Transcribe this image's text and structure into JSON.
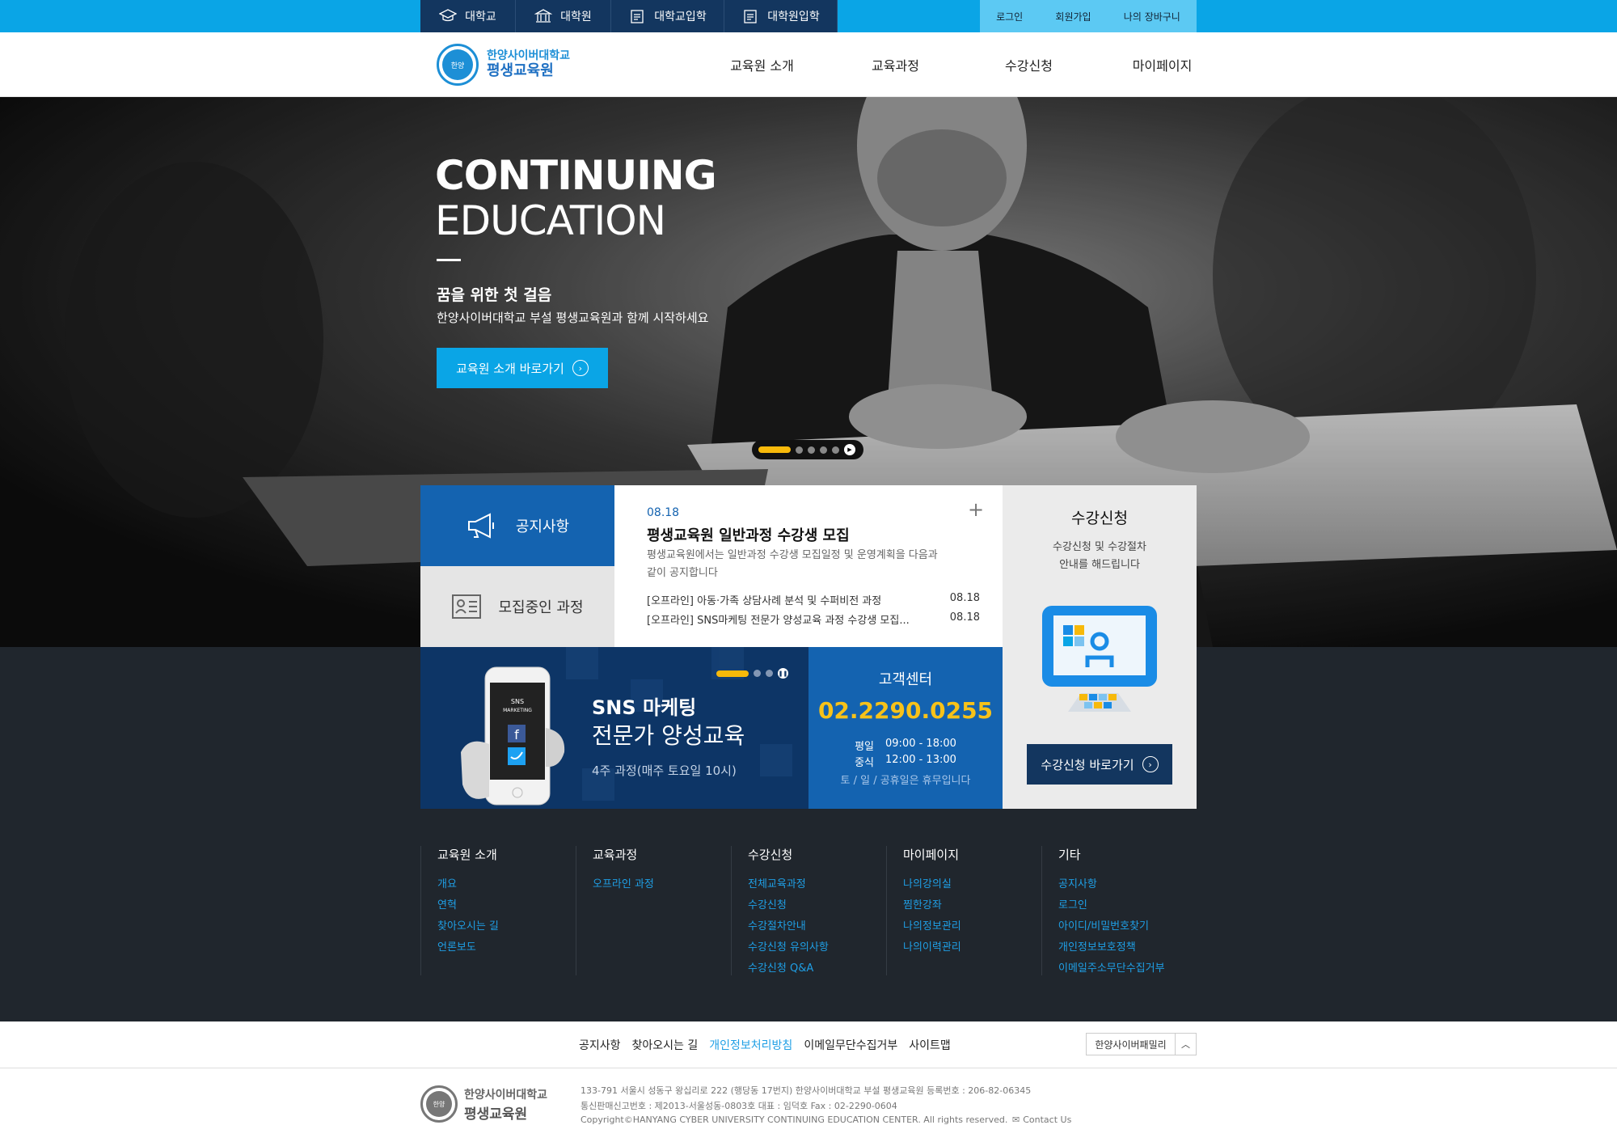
{
  "topbar": {
    "sites": [
      {
        "label": "대학교",
        "icon": "graduation-cap-icon"
      },
      {
        "label": "대학원",
        "icon": "building-icon"
      },
      {
        "label": "대학교입학",
        "icon": "document-icon"
      },
      {
        "label": "대학원입학",
        "icon": "document-icon"
      }
    ],
    "util": {
      "login": "로그인",
      "join": "회원가입",
      "cart": "나의 장바구니"
    }
  },
  "header": {
    "logo_line1": "한양사이버대학교",
    "logo_line2": "평생교육원",
    "seal_text": "한양",
    "nav": [
      "교육원 소개",
      "교육과정",
      "수강신청",
      "마이페이지"
    ]
  },
  "hero": {
    "title_bold": "CONTINUING",
    "title_light": "EDUCATION",
    "subtitle": "꿈을 위한 첫 걸음",
    "description": "한양사이버대학교 부설 평생교육원과 함께 시작하세요",
    "button": "교육원 소개 바로가기"
  },
  "notice": {
    "tab_notice": "공지사항",
    "tab_courses": "모집중인 과정",
    "featured_date": "08.18",
    "featured_title": "평생교육원 일반과정 수강생 모집",
    "featured_desc": "평생교육원에서는 일반과정 수강생 모집일정 및 운영계획을 다음과 같이 공지합니다",
    "items": [
      {
        "title": "[오프라인] 아동·가족 상담사례 분석 및 수퍼비전 과정",
        "date": "08.18"
      },
      {
        "title": "[오프라인] SNS마케팅 전문가 양성교육 과정 수강생 모집...",
        "date": "08.18"
      }
    ]
  },
  "register": {
    "title": "수강신청",
    "desc1": "수강신청 및 수강절차",
    "desc2": "안내를 해드립니다",
    "button": "수강신청 바로가기"
  },
  "sns_banner": {
    "title1": "SNS 마케팅",
    "title2": "전문가 양성교육",
    "sub": "4주 과정(매주 토요일 10시)",
    "phone_text1": "SNS",
    "phone_text2": "MARKETING"
  },
  "customer_center": {
    "title": "고객센터",
    "phone": "02.2290.0255",
    "weekday_label": "평일",
    "weekday_hours": "09:00 - 18:00",
    "lunch_label": "중식",
    "lunch_hours": "12:00 - 13:00",
    "note": "토 / 일 / 공휴일은 휴무입니다"
  },
  "footer_menu": [
    {
      "title": "교육원 소개",
      "links": [
        "개요",
        "연혁",
        "찾아오시는 길",
        "언론보도"
      ]
    },
    {
      "title": "교육과정",
      "links": [
        "오프라인 과정"
      ]
    },
    {
      "title": "수강신청",
      "links": [
        "전체교육과정",
        "수강신청",
        "수강절차안내",
        "수강신청 유의사항",
        "수강신청 Q&A"
      ]
    },
    {
      "title": "마이페이지",
      "links": [
        "나의강의실",
        "찜한강좌",
        "나의정보관리",
        "나의이력관리"
      ]
    },
    {
      "title": "기타",
      "links": [
        "공지사항",
        "로그인",
        "아이디/비밀번호찾기",
        "개인정보보호정책",
        "이메일주소무단수집거부"
      ]
    }
  ],
  "bottom_links": [
    "공지사항",
    "찾아오시는 길",
    "개인정보처리방침",
    "이메일무단수집거부",
    "사이트맵"
  ],
  "family_site": "한양사이버패밀리",
  "address": {
    "line1": "133-791 서울시 성동구 왕십리로 222 (행당동 17번지) 한양사이버대학교 부설 평생교육원 등록번호 : 206-82-06345",
    "line2": "통신판매신고번호 : 제2013-서울성동-0803호  대표 : 임덕호   Fax : 02-2290-0604",
    "line3": "Copyright©HANYANG CYBER UNIVERSITY CONTINUING EDUCATION CENTER. All rights reserved.",
    "contact": "Contact Us"
  },
  "colors": {
    "accent": "#0aa5e6",
    "navy": "#13365f",
    "blue": "#1463b0",
    "yellow": "#f7b90a",
    "dark": "#20262d"
  }
}
